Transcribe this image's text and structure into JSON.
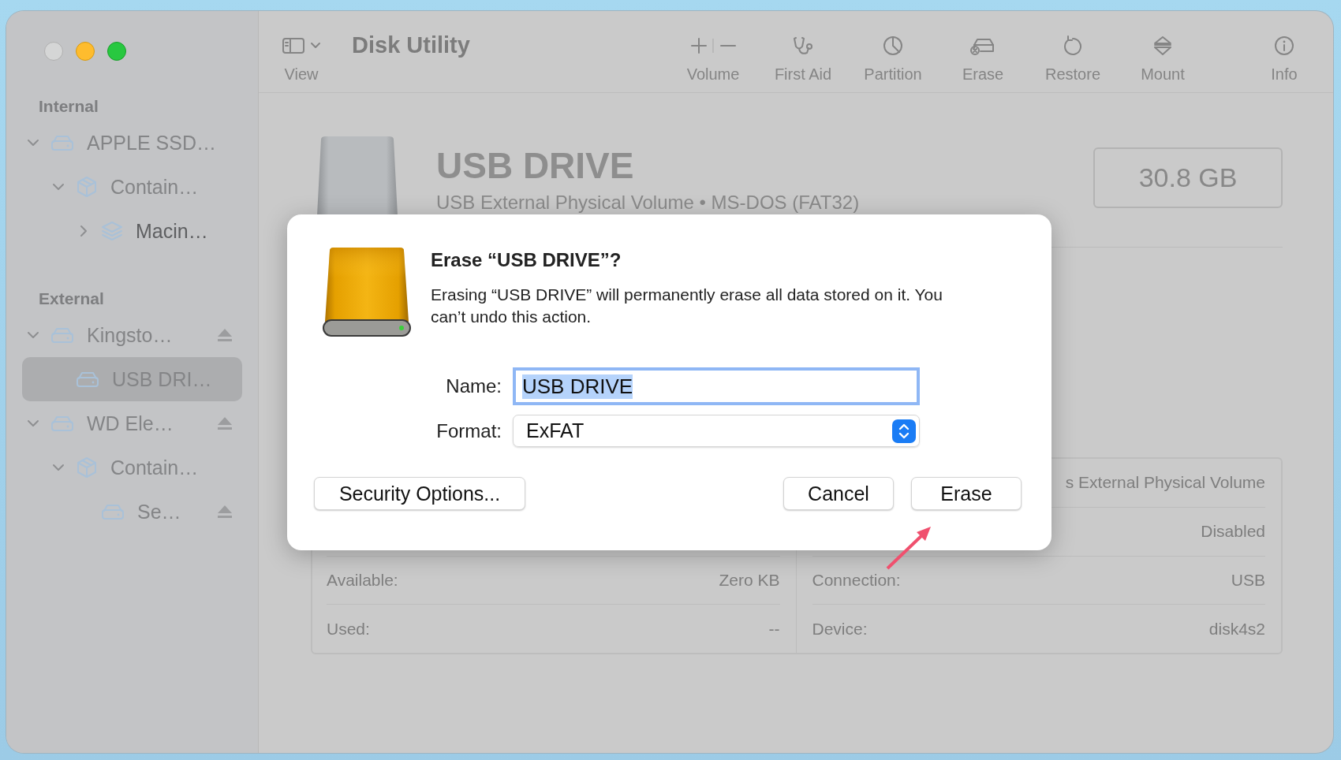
{
  "window": {
    "controls": [
      {
        "kind": "close",
        "color": "#d5d6d6"
      },
      {
        "kind": "minimize",
        "color": "#febc2e"
      },
      {
        "kind": "zoom",
        "color": "#28c840"
      }
    ]
  },
  "sidebar": {
    "sections": [
      {
        "title": "Internal",
        "items": [
          {
            "label": "APPLE SSD…",
            "kind": "drive",
            "expanded": true,
            "selected": false,
            "ejectable": false,
            "children": [
              {
                "label": "Contain…",
                "kind": "container",
                "expanded": true,
                "selected": false,
                "ejectable": false,
                "children": [
                  {
                    "label": "Macin…",
                    "kind": "volume",
                    "expanded": false,
                    "selected": false,
                    "ejectable": false
                  }
                ]
              }
            ]
          }
        ]
      },
      {
        "title": "External",
        "items": [
          {
            "label": "Kingsto…",
            "kind": "drive",
            "expanded": true,
            "selected": false,
            "ejectable": true,
            "children": [
              {
                "label": "USB DRI…",
                "kind": "drive",
                "selected": true,
                "ejectable": false
              }
            ]
          },
          {
            "label": "WD Ele…",
            "kind": "drive",
            "expanded": true,
            "selected": false,
            "ejectable": true,
            "children": [
              {
                "label": "Contain…",
                "kind": "container",
                "expanded": true,
                "selected": false,
                "ejectable": false,
                "children": [
                  {
                    "label": "Se…",
                    "kind": "drive",
                    "selected": false,
                    "ejectable": true
                  }
                ]
              }
            ]
          }
        ]
      }
    ]
  },
  "toolbar": {
    "view_label": "View",
    "title": "Disk Utility",
    "buttons": [
      {
        "kind": "volume",
        "label": "Volume"
      },
      {
        "kind": "first-aid",
        "label": "First Aid"
      },
      {
        "kind": "partition",
        "label": "Partition"
      },
      {
        "kind": "erase",
        "label": "Erase"
      },
      {
        "kind": "restore",
        "label": "Restore"
      },
      {
        "kind": "mount",
        "label": "Mount"
      },
      {
        "kind": "info",
        "label": "Info"
      }
    ]
  },
  "header": {
    "name": "USB DRIVE",
    "subtitle": "USB External Physical Volume • MS-DOS (FAT32)",
    "capacity": "30.8 GB"
  },
  "info": {
    "rows": [
      {
        "right_value": "s External Physical Volume"
      },
      {
        "right_value": "Disabled"
      },
      {
        "left_label": "Available:",
        "left_value": "Zero KB",
        "right_label": "Connection:",
        "right_value": "USB"
      },
      {
        "left_label": "Used:",
        "left_value": "--",
        "right_label": "Device:",
        "right_value": "disk4s2"
      }
    ]
  },
  "dialog": {
    "title": "Erase “USB DRIVE”?",
    "message": "Erasing “USB DRIVE” will permanently erase all data stored on it. You can’t undo this action.",
    "fields": [
      {
        "kind": "text",
        "label": "Name:",
        "value": "USB DRIVE",
        "focused": true,
        "text_selected": true
      },
      {
        "kind": "popup",
        "label": "Format:",
        "value": "ExFAT"
      }
    ],
    "buttons": [
      {
        "label": "Security Options...",
        "kind": "left"
      },
      {
        "label": "Cancel",
        "kind": "right"
      },
      {
        "label": "Erase",
        "kind": "right"
      }
    ]
  },
  "annotations": [
    {
      "kind": "arrow",
      "color": "#f0506e"
    }
  ]
}
